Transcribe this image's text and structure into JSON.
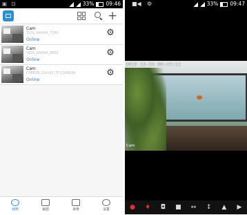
{
  "left_screen": {
    "status_bar": {
      "left_icons": "▣ ⊡",
      "battery": "33%",
      "time": "09:46"
    },
    "header": {
      "logo_icon": "camera-logo-icon",
      "grid_icon": "grid-icon",
      "search_icon": "search-icon",
      "add_label": "+"
    },
    "cameras": [
      {
        "name": "Cam",
        "id": "SSSS_AAAAA_7189",
        "status": "Online"
      },
      {
        "name": "Cam",
        "id": "SSSS_AAAAA_8669",
        "status": "Online"
      },
      {
        "name": "Cam",
        "id": "CPBBZB-154243_TF1CH8W84",
        "status": "Online"
      }
    ],
    "nav": [
      {
        "label": "视频",
        "active": true
      },
      {
        "label": "截图"
      },
      {
        "label": "录像"
      },
      {
        "label": "设置"
      }
    ],
    "colors": {
      "accent": "#2b8fd6",
      "online": "#2b7fc8"
    }
  },
  "right_screen": {
    "status_bar": {
      "left_icons": "▣ ⊡",
      "battery": "33%",
      "time": "09:47"
    },
    "top_icons": {
      "record": "record-icon",
      "settings": "settings-icon"
    },
    "osd_timestamp": "2015 12-24 09:47:11",
    "osd_cam": "Cam",
    "controls": [
      "record-dot-icon",
      "mic-icon",
      "snapshot-icon",
      "video-icon",
      "horizontal-flip-icon",
      "vertical-flip-icon",
      "mirror-icon",
      "play-icon"
    ]
  }
}
